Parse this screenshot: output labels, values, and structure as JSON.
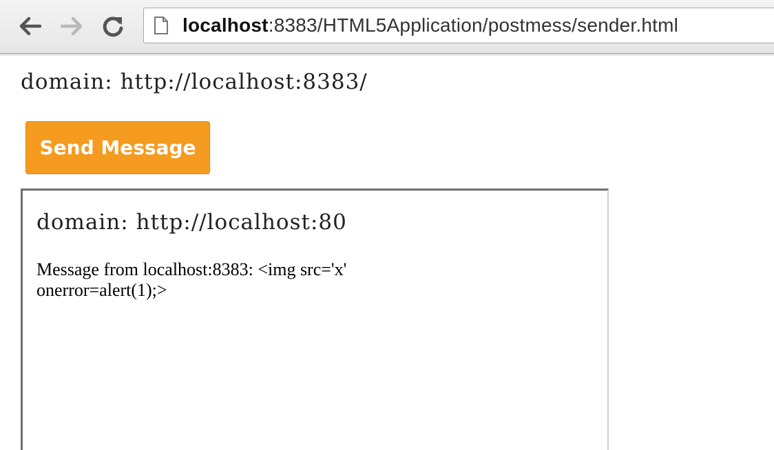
{
  "browser": {
    "url_host": "localhost",
    "url_rest": ":8383/HTML5Application/postmess/sender.html"
  },
  "page": {
    "domain_text": "domain: http://localhost:8383/",
    "send_button_label": "Send Message",
    "button_color": "#f59b1f"
  },
  "iframe": {
    "domain_text": "domain: http://localhost:80",
    "message_line1": "Message from localhost:8383: <img src='x'",
    "message_line2": "onerror=alert(1);>"
  }
}
